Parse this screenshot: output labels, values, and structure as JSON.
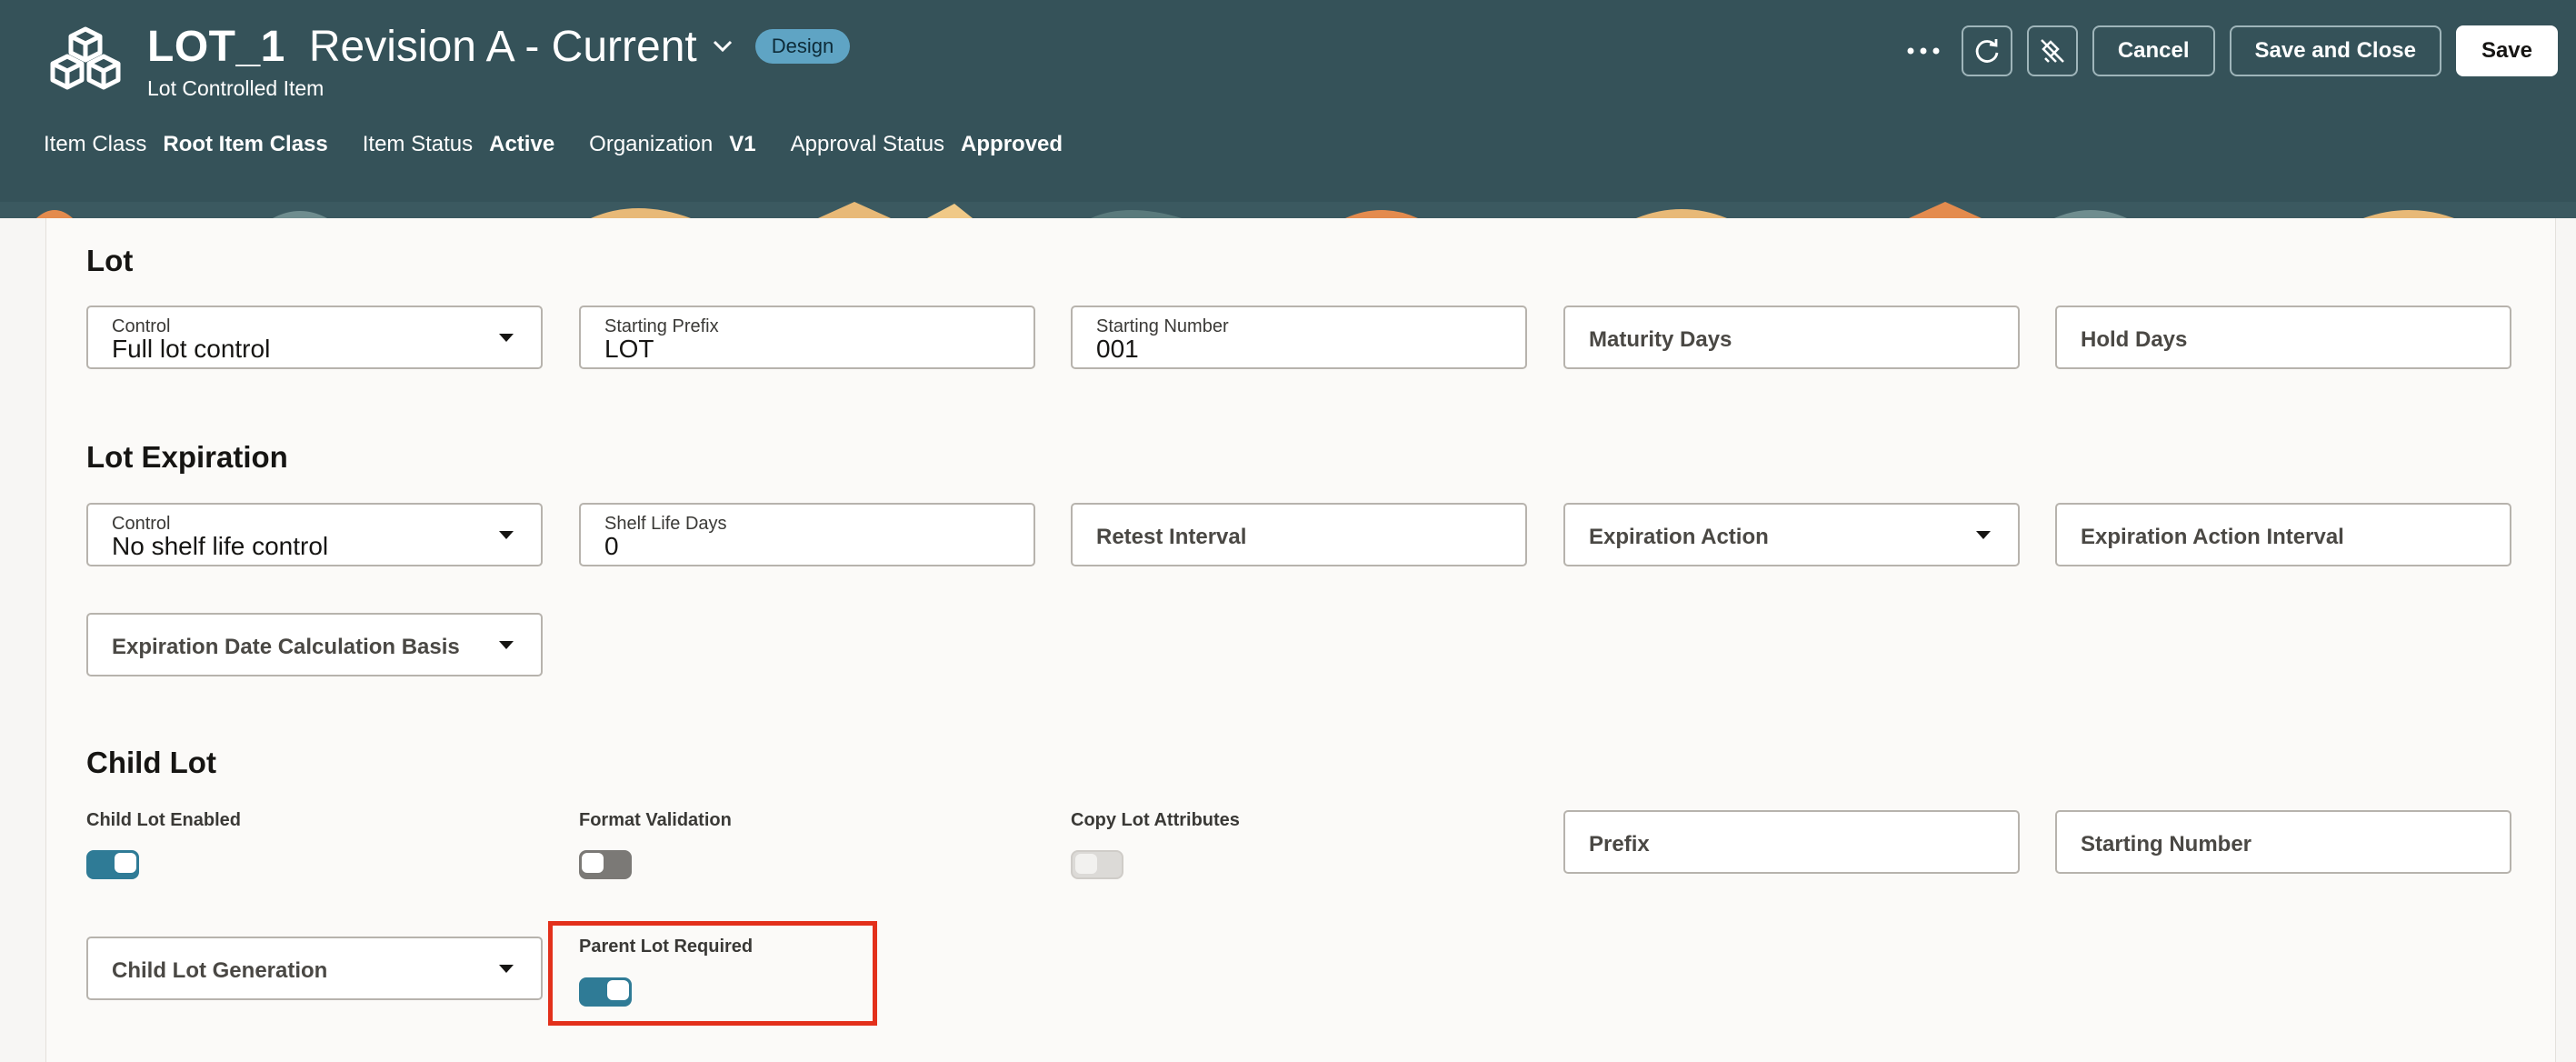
{
  "header": {
    "item_number": "LOT_1",
    "revision": "Revision A - Current",
    "badge": "Design",
    "subtitle": "Lot Controlled Item",
    "meta": [
      {
        "key": "Item Class",
        "value": "Root Item Class"
      },
      {
        "key": "Item Status",
        "value": "Active"
      },
      {
        "key": "Organization",
        "value": "V1"
      },
      {
        "key": "Approval Status",
        "value": "Approved"
      }
    ],
    "actions": {
      "cancel": "Cancel",
      "save_close": "Save and Close",
      "save": "Save"
    },
    "icons": [
      "cubes-logo-icon",
      "chevron-down-icon",
      "more-icon",
      "refresh-icon",
      "clear-icon"
    ],
    "colors": {
      "header_bg": "#355259",
      "badge_bg": "#5fa4c4",
      "accent": "#2f7b96",
      "highlight": "#e3301b"
    }
  },
  "lot": {
    "title": "Lot",
    "control": {
      "label": "Control",
      "value": "Full lot control"
    },
    "starting_prefix": {
      "label": "Starting Prefix",
      "value": "LOT"
    },
    "starting_number": {
      "label": "Starting Number",
      "value": "001"
    },
    "maturity_days": {
      "placeholder": "Maturity Days"
    },
    "hold_days": {
      "placeholder": "Hold Days"
    }
  },
  "lot_expiration": {
    "title": "Lot Expiration",
    "control": {
      "label": "Control",
      "value": "No shelf life control"
    },
    "shelf_life_days": {
      "label": "Shelf Life Days",
      "value": "0"
    },
    "retest_interval": {
      "placeholder": "Retest Interval"
    },
    "expiration_action": {
      "placeholder": "Expiration Action"
    },
    "expiration_action_interval": {
      "placeholder": "Expiration Action Interval"
    },
    "calc_basis": {
      "placeholder": "Expiration Date Calculation Basis"
    }
  },
  "child_lot": {
    "title": "Child Lot",
    "child_lot_enabled": {
      "label": "Child Lot Enabled",
      "state": "on"
    },
    "format_validation": {
      "label": "Format Validation",
      "state": "off"
    },
    "copy_lot_attributes": {
      "label": "Copy Lot Attributes",
      "state": "disabled"
    },
    "prefix": {
      "placeholder": "Prefix"
    },
    "starting_number": {
      "placeholder": "Starting Number"
    },
    "generation": {
      "placeholder": "Child Lot Generation"
    },
    "parent_lot_required": {
      "label": "Parent Lot Required",
      "state": "on"
    }
  }
}
